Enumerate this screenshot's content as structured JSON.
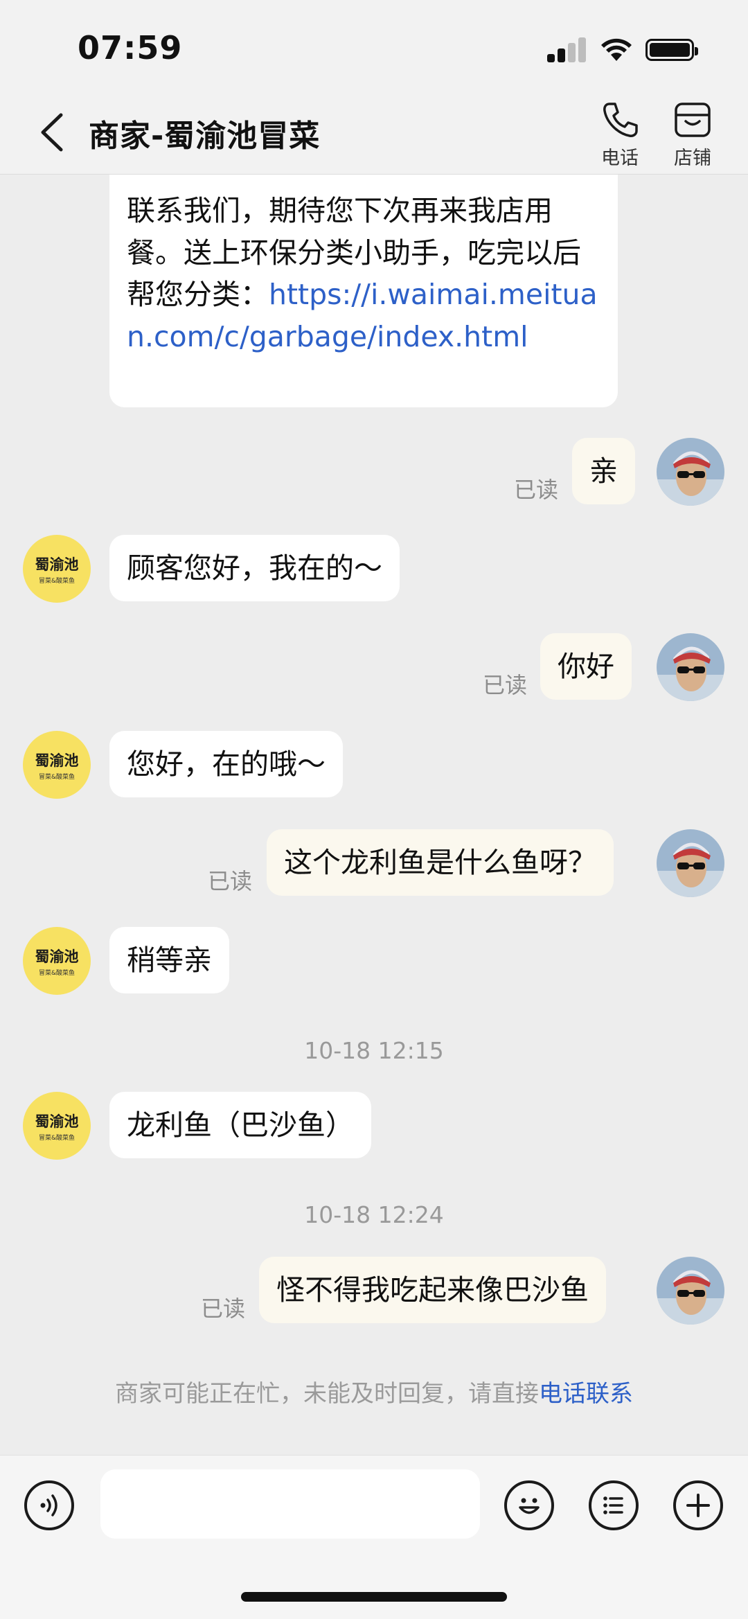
{
  "status_bar": {
    "time": "07:59"
  },
  "header": {
    "title": "商家-蜀渝池冒菜",
    "phone_label": "电话",
    "store_label": "店铺"
  },
  "shop": {
    "avatar_name": "蜀渝池",
    "avatar_sub": "冒菜&酸菜鱼"
  },
  "messages": {
    "m0_text": "联系我们，期待您下次再来我店用餐。送上环保分类小助手，吃完以后帮您分类：",
    "m0_link": "https://i.waimai.meituan.com/c/garbage/index.html",
    "m1": "亲",
    "m2": "顾客您好，我在的～",
    "m3": "你好",
    "m4": "您好，在的哦～",
    "m5": "这个龙利鱼是什么鱼呀？",
    "m6": "稍等亲",
    "m7": "龙利鱼（巴沙鱼）",
    "m8": "怪不得我吃起来像巴沙鱼"
  },
  "read_label": "已读",
  "timestamps": {
    "t1": "10-18 12:15",
    "t2": "10-18 12:24"
  },
  "notice": {
    "text": "商家可能正在忙，未能及时回复，请直接",
    "link": "电话联系"
  },
  "input": {
    "placeholder": ""
  },
  "icons": [
    "back-icon",
    "phone-icon",
    "store-icon",
    "voice-icon",
    "emoji-icon",
    "menu-icon",
    "plus-icon"
  ],
  "colors": {
    "link": "#2d60c8",
    "shop_avatar": "#f7e162",
    "outgoing_bubble": "#fbf8ee"
  }
}
